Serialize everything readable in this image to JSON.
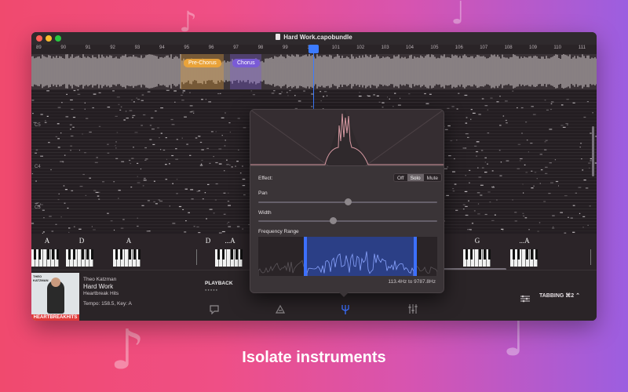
{
  "window": {
    "title": "Hard Work.capobundle"
  },
  "ruler": {
    "bars": [
      "89",
      "90",
      "91",
      "92",
      "93",
      "94",
      "95",
      "96",
      "97",
      "98",
      "99",
      "100",
      "101",
      "102",
      "103",
      "104",
      "105",
      "106",
      "107",
      "108",
      "109",
      "110",
      "111"
    ]
  },
  "sections": [
    {
      "label": "Pre-Chorus",
      "color": "#e9a33a"
    },
    {
      "label": "Chorus",
      "color": "#7a5bd6"
    }
  ],
  "pianoroll": {
    "octave_labels": [
      "C5",
      "C4",
      "C3"
    ]
  },
  "chords": [
    {
      "name": "A"
    },
    {
      "name": "D"
    },
    {
      "name": "A"
    },
    {
      "name": "D"
    },
    {
      "name": "...A"
    },
    {
      "name": "G"
    },
    {
      "name": "...A"
    }
  ],
  "track": {
    "album_artist_text": "THEO KATZMAN",
    "album_title_text": "HEARTBREAKHITS",
    "artist": "Theo Katzman",
    "title": "Hard Work",
    "album": "Heartbreak Hits",
    "info": "Tempo: 158.5, Key: A"
  },
  "playback": {
    "label": "PLAYBACK"
  },
  "tabbing": {
    "label": "TABBING ⌘2 ⌃"
  },
  "toolbar": {
    "icons": [
      "comment-icon",
      "tuning-fork-icon",
      "isolate-instrument-icon",
      "mixer-icon"
    ]
  },
  "popover": {
    "effect_label": "Effect:",
    "effect_options": [
      "Off",
      "Solo",
      "Mute"
    ],
    "effect_selected": "Solo",
    "pan_label": "Pan",
    "pan_value": 0.5,
    "width_label": "Width",
    "width_value": 0.42,
    "freq_label": "Frequency Range",
    "freq_text": "113.4Hz to 9787.8Hz"
  },
  "caption": "Isolate instruments",
  "colors": {
    "accent": "#3c70ff",
    "bg_left": "#f04a6e",
    "bg_right": "#9c5ee0"
  }
}
